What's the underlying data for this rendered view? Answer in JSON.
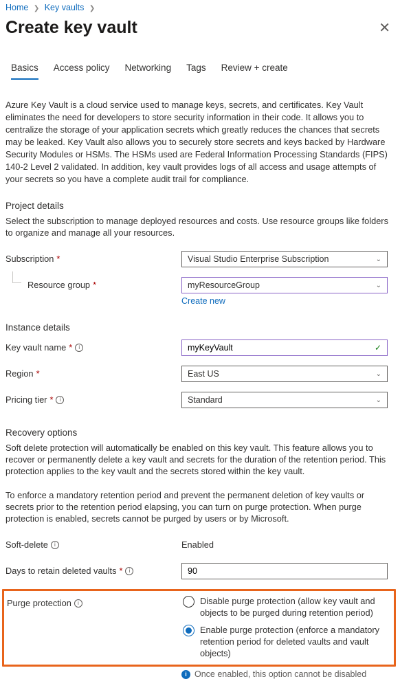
{
  "breadcrumb": {
    "home": "Home",
    "kv": "Key vaults"
  },
  "title": "Create key vault",
  "tabs": {
    "basics": "Basics",
    "access": "Access policy",
    "net": "Networking",
    "tags": "Tags",
    "review": "Review + create"
  },
  "intro": "Azure Key Vault is a cloud service used to manage keys, secrets, and certificates. Key Vault eliminates the need for developers to store security information in their code. It allows you to centralize the storage of your application secrets which greatly reduces the chances that secrets may be leaked. Key Vault also allows you to securely store secrets and keys backed by Hardware Security Modules or HSMs. The HSMs used are Federal Information Processing Standards (FIPS) 140-2 Level 2 validated. In addition, key vault provides logs of all access and usage attempts of your secrets so you have a complete audit trail for compliance.",
  "project": {
    "head": "Project details",
    "desc": "Select the subscription to manage deployed resources and costs. Use resource groups like folders to organize and manage all your resources.",
    "sub_label": "Subscription",
    "sub_value": "Visual Studio Enterprise Subscription",
    "rg_label": "Resource group",
    "rg_value": "myResourceGroup",
    "create_new": "Create new"
  },
  "instance": {
    "head": "Instance details",
    "name_label": "Key vault name",
    "name_value": "myKeyVault",
    "region_label": "Region",
    "region_value": "East US",
    "tier_label": "Pricing tier",
    "tier_value": "Standard"
  },
  "recovery": {
    "head": "Recovery options",
    "desc1": "Soft delete protection will automatically be enabled on this key vault. This feature allows you to recover or permanently delete a key vault and secrets for the duration of the retention period. This protection applies to the key vault and the secrets stored within the key vault.",
    "desc2": "To enforce a mandatory retention period and prevent the permanent deletion of key vaults or secrets prior to the retention period elapsing, you can turn on purge protection. When purge protection is enabled, secrets cannot be purged by users or by Microsoft.",
    "soft_label": "Soft-delete",
    "soft_value": "Enabled",
    "days_label": "Days to retain deleted vaults",
    "days_value": "90",
    "purge_label": "Purge protection",
    "purge_opt1": "Disable purge protection (allow key vault and objects to be purged during retention period)",
    "purge_opt2": "Enable purge protection (enforce a mandatory retention period for deleted vaults and vault objects)",
    "note": "Once enabled, this option cannot be disabled"
  }
}
